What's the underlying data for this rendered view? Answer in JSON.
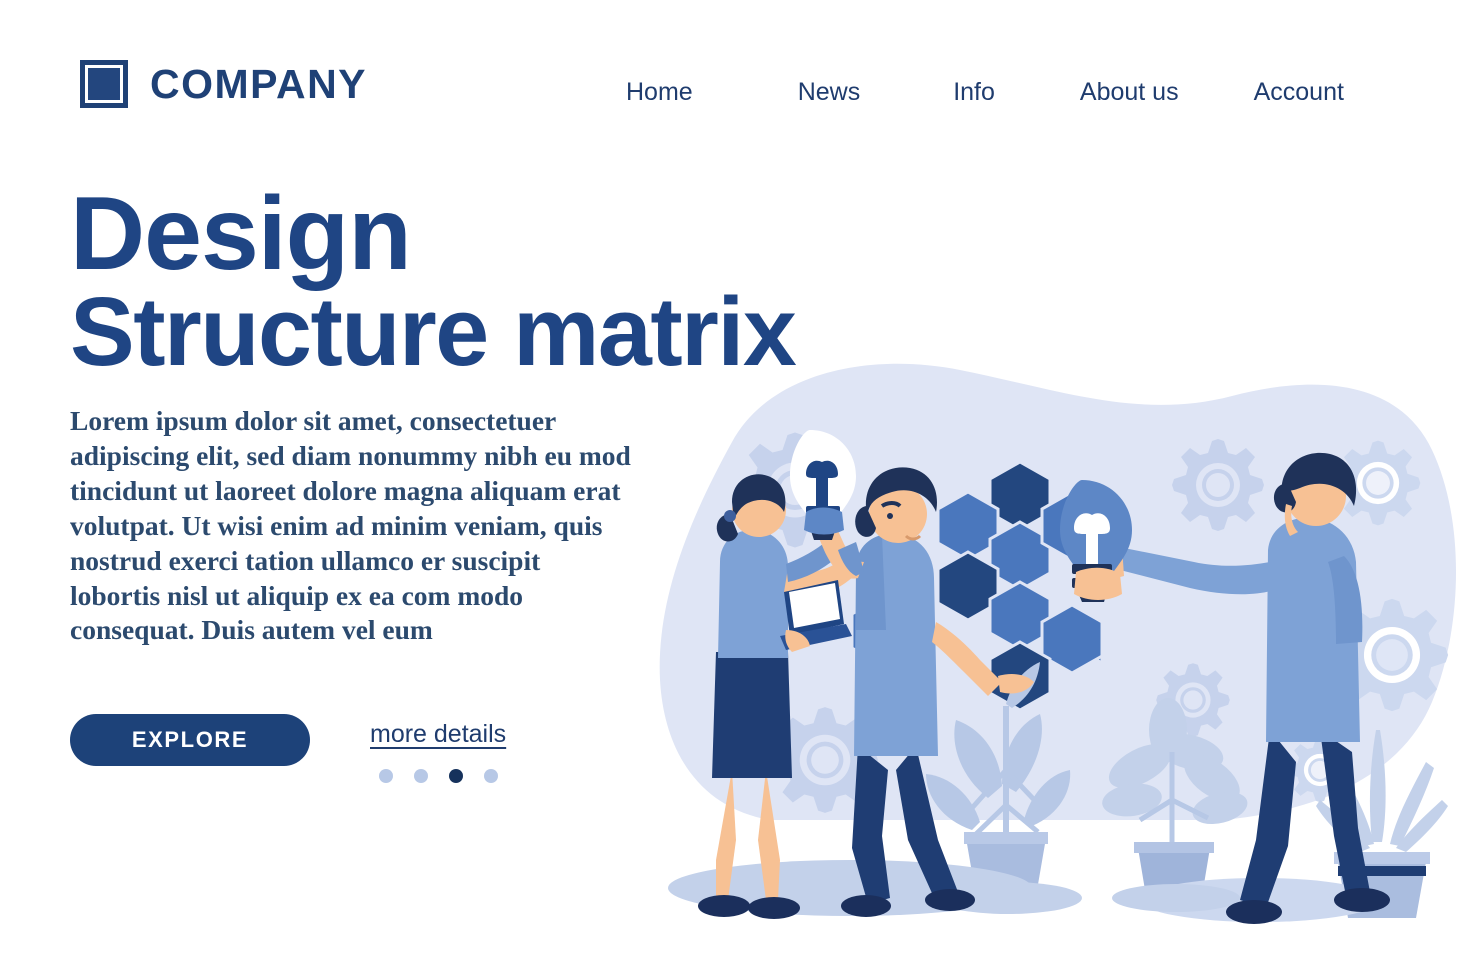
{
  "header": {
    "logo_icon": "square-logo-icon",
    "brand_name": "COMPANY",
    "nav_items": [
      {
        "label": "Home"
      },
      {
        "label": "News"
      },
      {
        "label": "Info"
      },
      {
        "label": "About us"
      },
      {
        "label": "Account"
      }
    ]
  },
  "hero": {
    "headline_line1": "Design",
    "headline_line2": "Structure matrix",
    "paragraph": "Lorem ipsum dolor sit amet, consectetuer adipiscing elit, sed diam nonummy nibh eu mod tincidunt ut laoreet dolore magna aliquam erat volutpat. Ut wisi enim ad minim veniam, quis nostrud exerci tation ullamco er suscipit lobortis nisl ut aliquip ex ea com modo consequat. Duis autem vel eum",
    "cta_label": "EXPLORE",
    "more_details_label": "more details",
    "carousel": {
      "total": 4,
      "active_index": 2
    }
  },
  "illustration": {
    "alt": "flat illustration of three people with lightbulbs, hexagon honeycomb, gears and potted plants",
    "figures": [
      {
        "name": "woman-with-laptop"
      },
      {
        "name": "man-with-lightbulb-center"
      },
      {
        "name": "man-with-lightbulb-right"
      }
    ],
    "props": [
      {
        "name": "hexagon-cluster"
      },
      {
        "name": "gear-decorations"
      },
      {
        "name": "potted-plant-left"
      },
      {
        "name": "potted-plant-center"
      },
      {
        "name": "potted-plant-right"
      }
    ]
  },
  "colors": {
    "brand_navy": "#1f4176",
    "headline_blue": "#1f4584",
    "body_text": "#2c4a6e",
    "cta_fill": "#1d4279",
    "dot_inactive": "#b7c8e6",
    "dot_active": "#16325c",
    "blob_bg": "#dfe5f5",
    "hex_mid": "#4a77bd",
    "hex_dark": "#23477f",
    "skin": "#f7c194",
    "shirt_blue": "#7ea2d6",
    "pants_navy": "#1f3d73",
    "plant_leaf": "#b7c8e6",
    "page_bg": "#ffffff"
  }
}
